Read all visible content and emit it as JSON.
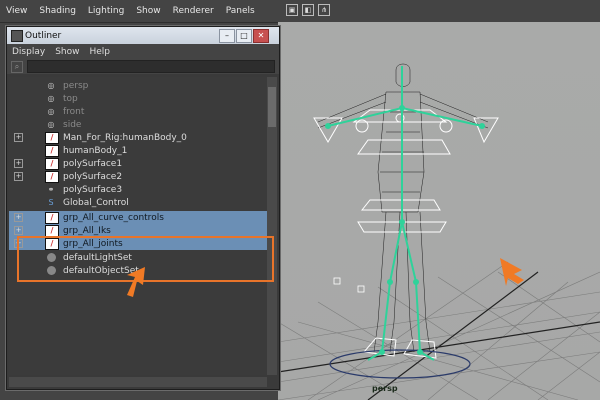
{
  "menubar": {
    "items": [
      "View",
      "Shading",
      "Lighting",
      "Show",
      "Renderer",
      "Panels"
    ]
  },
  "viewport": {
    "camera_label": "persp"
  },
  "outliner": {
    "title": "Outliner",
    "menu": [
      "Display",
      "Show",
      "Help"
    ],
    "search_value": "",
    "items": [
      {
        "label": "persp",
        "icon": "camera-icon",
        "dim": true
      },
      {
        "label": "top",
        "icon": "camera-icon",
        "dim": true
      },
      {
        "label": "front",
        "icon": "camera-icon",
        "dim": true
      },
      {
        "label": "side",
        "icon": "camera-icon",
        "dim": true
      },
      {
        "label": "Man_For_Rig:humanBody_0",
        "icon": "mesh-icon",
        "expand": "+"
      },
      {
        "label": "humanBody_1",
        "icon": "mesh-icon"
      },
      {
        "label": "polySurface1",
        "icon": "mesh-icon",
        "expand": "+"
      },
      {
        "label": "polySurface2",
        "icon": "mesh-icon",
        "expand": "+"
      },
      {
        "label": "polySurface3",
        "icon": "group-icon"
      },
      {
        "label": "Global_Control",
        "icon": "curve-icon"
      },
      {
        "label": "grp_All_curve_controls",
        "icon": "mesh-icon",
        "expand": "+",
        "selected": true
      },
      {
        "label": "grp_All_Iks",
        "icon": "mesh-icon",
        "expand": "+",
        "selected": true
      },
      {
        "label": "grp_All_joints",
        "icon": "mesh-icon",
        "expand": "+",
        "selected": true
      },
      {
        "label": "defaultLightSet",
        "icon": "set-icon"
      },
      {
        "label": "defaultObjectSet",
        "icon": "set-icon"
      }
    ]
  },
  "colors": {
    "highlight": "#e8742a",
    "selection": "#6b8fb5",
    "rig_green": "#2fd29a"
  }
}
